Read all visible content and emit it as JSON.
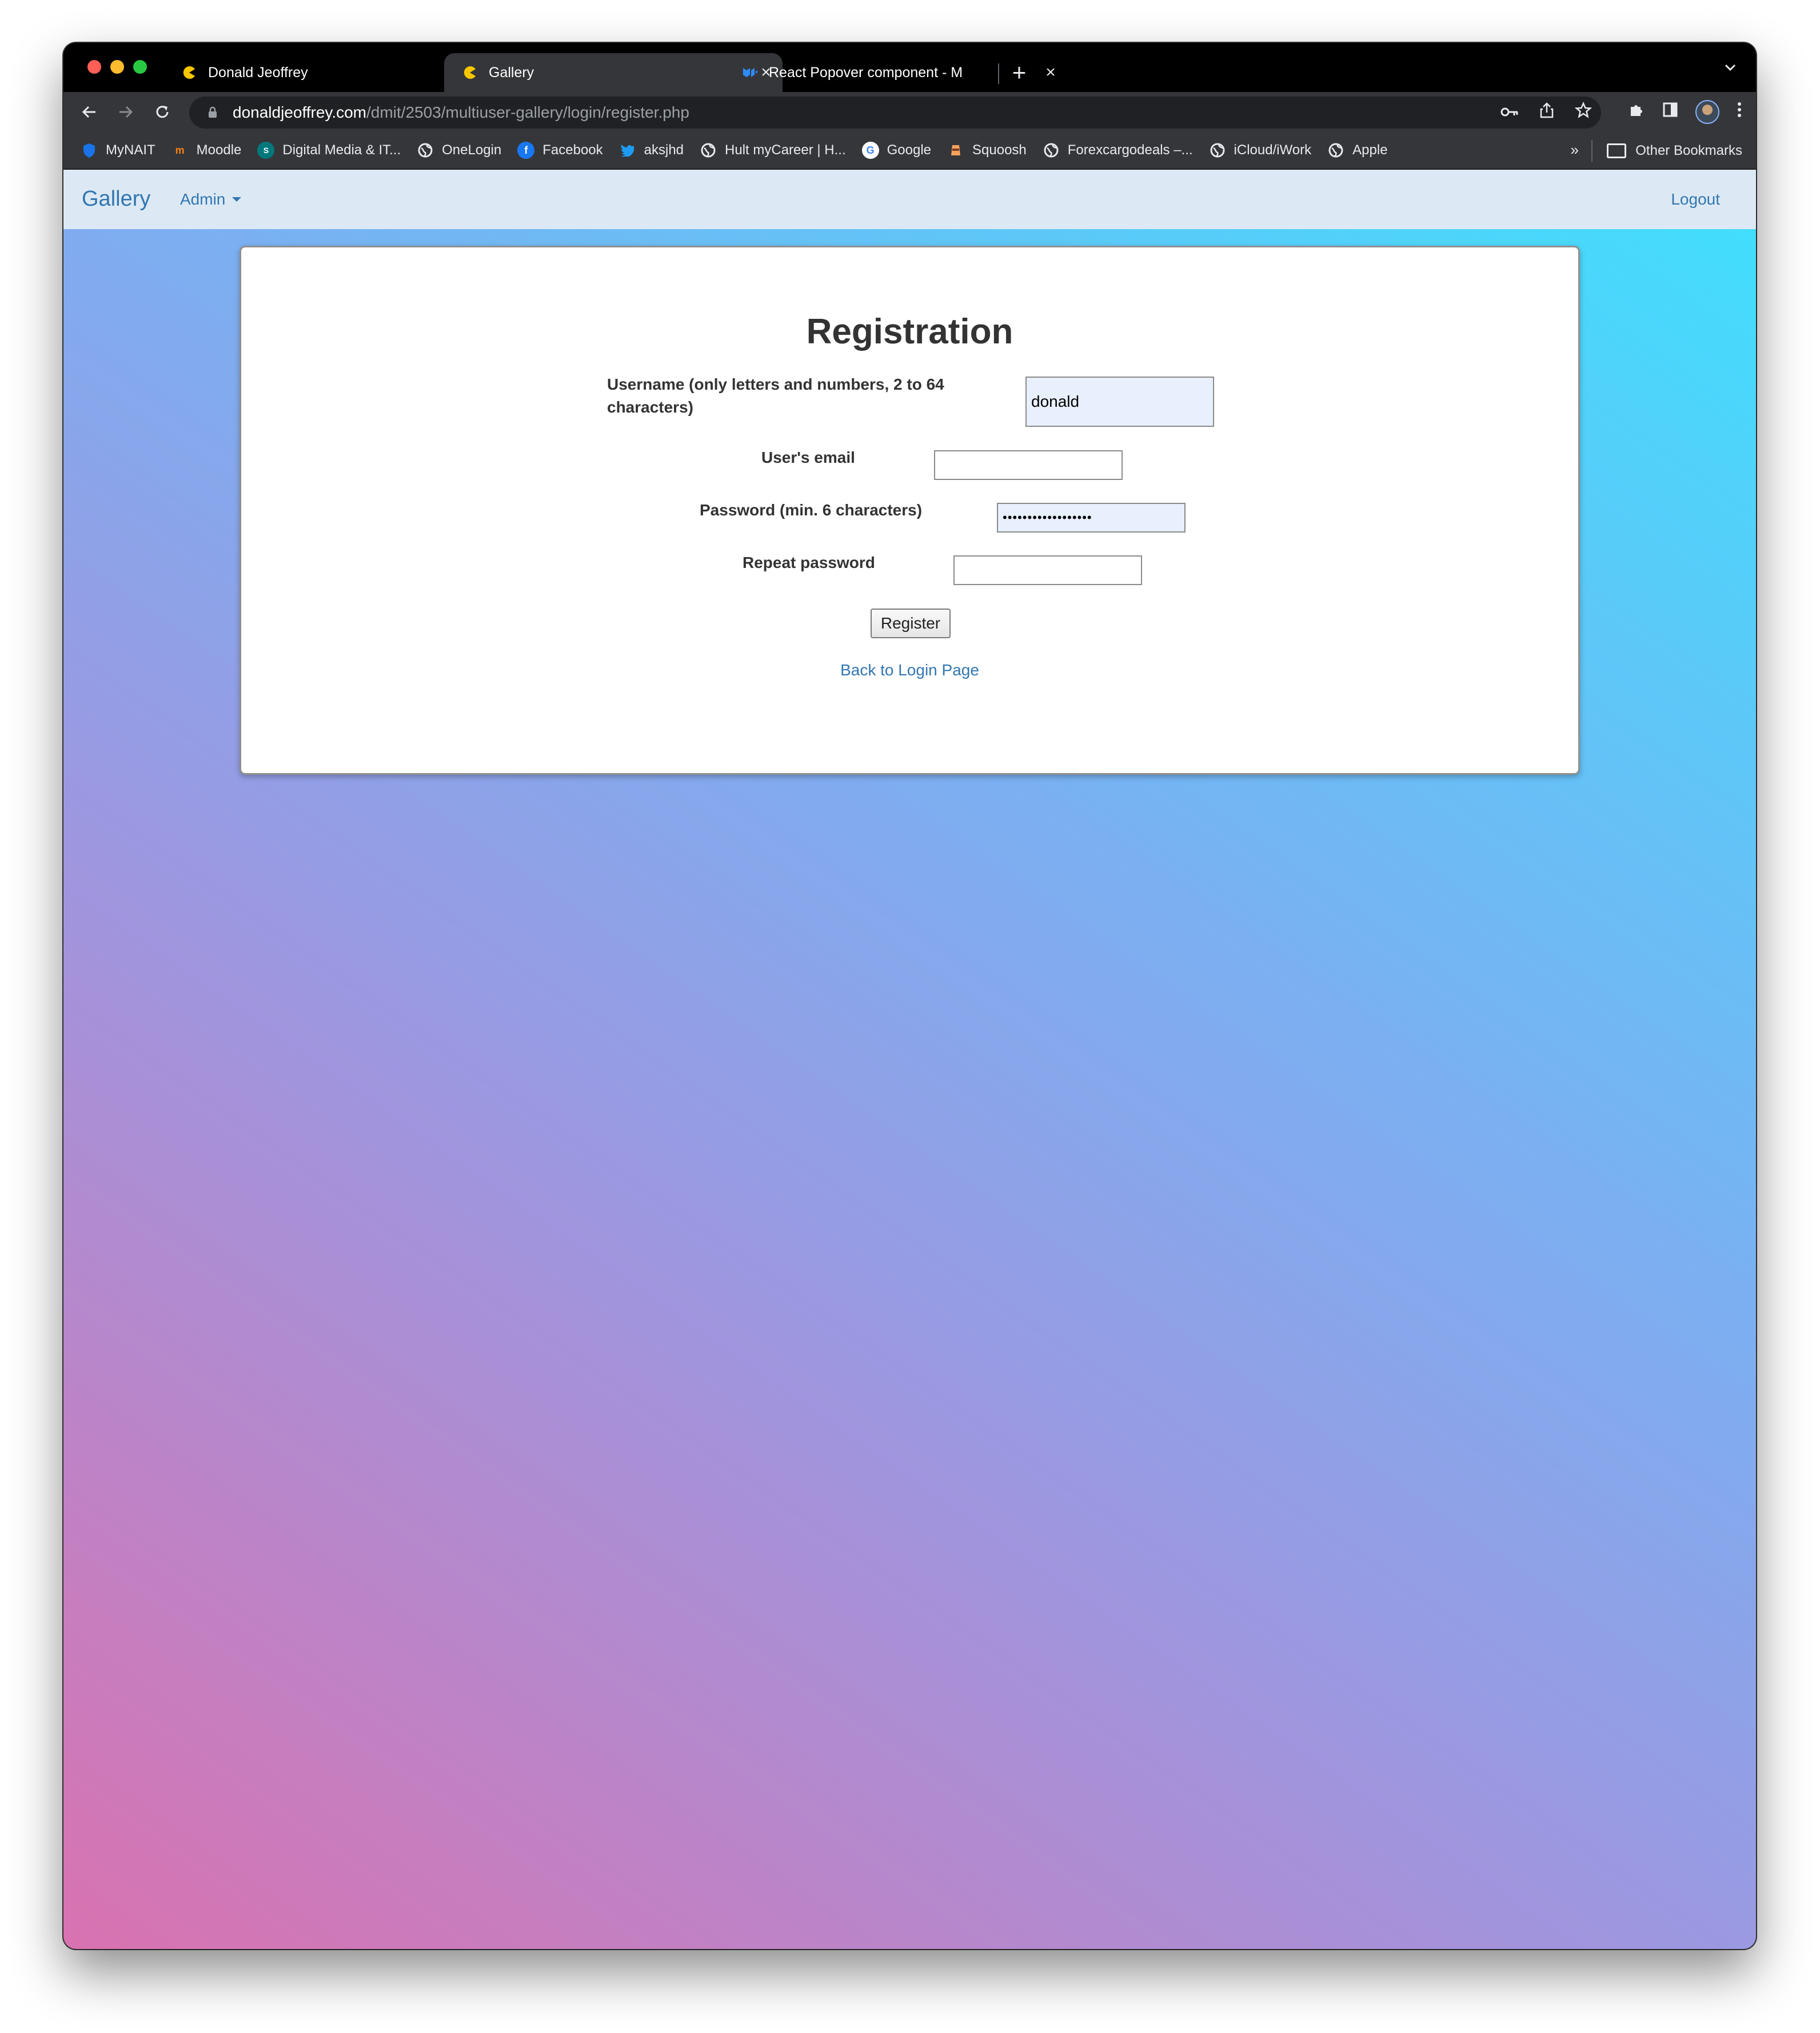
{
  "browser": {
    "tabs": [
      {
        "title": "Donald Jeoffrey",
        "active": false
      },
      {
        "title": "Gallery",
        "active": true
      },
      {
        "title": "React Popover component - M",
        "active": false
      }
    ],
    "new_tab_label": "+",
    "tab_search_label": "⌄",
    "url_host": "donaldjeoffrey.com",
    "url_path": "/dmit/2503/multiuser-gallery/login/register.php",
    "bookmarks": [
      {
        "label": "MyNAIT",
        "icon": "shield-icon",
        "color": "#1a73e8"
      },
      {
        "label": "Moodle",
        "icon": "moodle-icon",
        "color": "#f98012"
      },
      {
        "label": "Digital Media & IT...",
        "icon": "sharepoint-icon",
        "color": "#03787c"
      },
      {
        "label": "OneLogin",
        "icon": "globe-icon",
        "color": "#e8eaed"
      },
      {
        "label": "Facebook",
        "icon": "facebook-icon",
        "color": "#1877f2"
      },
      {
        "label": "aksjhd",
        "icon": "twitter-icon",
        "color": "#1d9bf0"
      },
      {
        "label": "Hult myCareer | H...",
        "icon": "globe-icon",
        "color": "#e8eaed"
      },
      {
        "label": "Google",
        "icon": "google-icon",
        "color": "#ffffff"
      },
      {
        "label": "Squoosh",
        "icon": "squoosh-icon",
        "color": "#f5a25d"
      },
      {
        "label": "Forexcargodeals –...",
        "icon": "globe-icon",
        "color": "#e8eaed"
      },
      {
        "label": "iCloud/iWork",
        "icon": "globe-icon",
        "color": "#e8eaed"
      },
      {
        "label": "Apple",
        "icon": "globe-icon",
        "color": "#e8eaed"
      }
    ],
    "bookmarks_more": "»",
    "other_bookmarks": "Other Bookmarks"
  },
  "navbar": {
    "brand": "Gallery",
    "admin_menu": "Admin",
    "logout": "Logout"
  },
  "form": {
    "heading": "Registration",
    "username_label": "Username (only letters and numbers, 2 to 64 characters)",
    "username_value": "donald",
    "email_label": "User's email",
    "email_value": "",
    "password_label": "Password (min. 6 characters)",
    "password_value": "••••••••••••••••••",
    "repeat_label": "Repeat password",
    "repeat_value": "",
    "submit_label": "Register",
    "back_link": "Back to Login Page"
  },
  "colors": {
    "link": "#3276b1",
    "navbar_bg": "#dce9f4",
    "autofill_bg": "#e8f0fe",
    "gradient_start": "#d972b0",
    "gradient_end": "#3fe0fe"
  }
}
